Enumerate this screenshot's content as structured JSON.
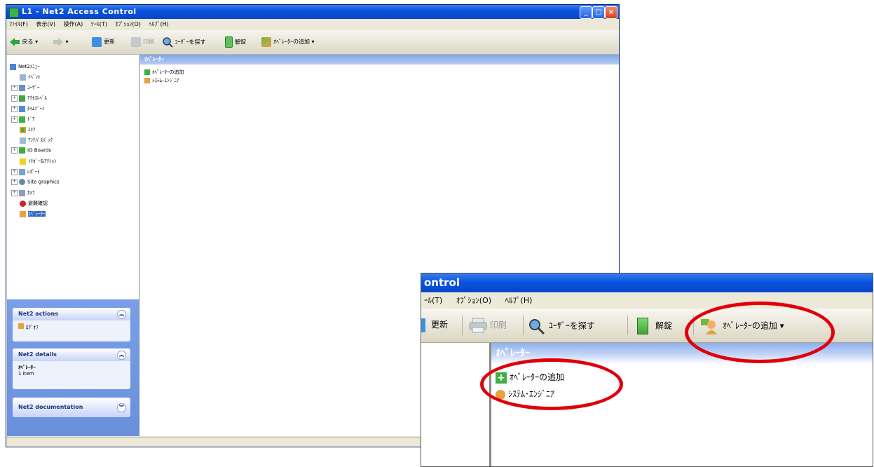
{
  "window": {
    "title": "L1 - Net2 Access Control",
    "menu": [
      "ﾌｧｲﾙ(F)",
      "表示(V)",
      "操作(A)",
      "ﾂｰﾙ(T)",
      "ｵﾌﾟｼｮﾝ(O)",
      "ﾍﾙﾌﾟ(H)"
    ],
    "toolbar": {
      "back": "戻る",
      "refresh": "更新",
      "print": "印刷",
      "find_user": "ﾕｰｻﾞｰを探す",
      "unlock": "解錠",
      "add_operator": "ｵﾍﾟﾚｰﾀｰの追加"
    }
  },
  "tree": [
    {
      "label": "Net2ﾒﾆｭｰ",
      "expandable": false,
      "selected": false
    },
    {
      "label": "ｲﾍﾞﾝﾄ",
      "expandable": false,
      "selected": false
    },
    {
      "label": "ﾕｰｻﾞｰ",
      "expandable": true,
      "selected": false
    },
    {
      "label": "ｱｸｾｽﾚﾍﾞﾙ",
      "expandable": true,
      "selected": false
    },
    {
      "label": "ﾀｲﾑｿﾞｰﾝ",
      "expandable": true,
      "selected": false
    },
    {
      "label": "ﾄﾞｱ",
      "expandable": true,
      "selected": false
    },
    {
      "label": "ｴﾘｱ",
      "expandable": false,
      "selected": false
    },
    {
      "label": "ｱﾝﾁﾊﾟｽﾊﾞｯｸ",
      "expandable": false,
      "selected": false
    },
    {
      "label": "IO Boards",
      "expandable": true,
      "selected": false
    },
    {
      "label": "ﾄﾘｶﾞｰ&ｱｸｼｮﾝ",
      "expandable": false,
      "selected": false
    },
    {
      "label": "ﾚﾎﾟｰﾄ",
      "expandable": true,
      "selected": false
    },
    {
      "label": "Site graphics",
      "expandable": true,
      "selected": false
    },
    {
      "label": "ｶﾒﾗ",
      "expandable": true,
      "selected": false
    },
    {
      "label": "避難確認",
      "expandable": false,
      "selected": false
    },
    {
      "label": "ｵﾍﾟﾚｰﾀｰ",
      "expandable": false,
      "selected": true
    }
  ],
  "tasks": {
    "actions": {
      "title": "Net2 actions",
      "item": "ﾛｸﾞｵﾌ"
    },
    "details": {
      "title": "Net2 details",
      "line1": "ｵﾍﾟﾚｰﾀｰ",
      "line2": "1 item"
    },
    "documentation": {
      "title": "Net2 documentation"
    }
  },
  "content": {
    "header": "ｵﾍﾟﾚｰﾀｰ",
    "items": [
      "ｵﾍﾟﾚｰﾀｰの追加",
      "ｼｽﾃﾑ･ｴﾝｼﾞﾆｱ"
    ]
  },
  "inset": {
    "title": "ontrol",
    "menu": [
      "ｰﾙ(T)",
      "ｵﾌﾟｼｮﾝ(O)",
      "ﾍﾙﾌﾟ(H)"
    ],
    "refresh": "更新",
    "print": "印刷",
    "find_user": "ﾕｰｻﾞｰを探す",
    "unlock": "解錠",
    "add_operator": "ｵﾍﾟﾚｰﾀｰの追加",
    "header": "ｵﾍﾟﾚｰﾀｰ",
    "item_add": "ｵﾍﾟﾚｰﾀｰの追加",
    "item_engineer": "ｼｽﾃﾑ･ｴﾝｼﾞﾆｱ"
  },
  "colors": {
    "titlebar": "#0a53e0",
    "highlight": "#e0000a",
    "selected": "#316ac5"
  }
}
